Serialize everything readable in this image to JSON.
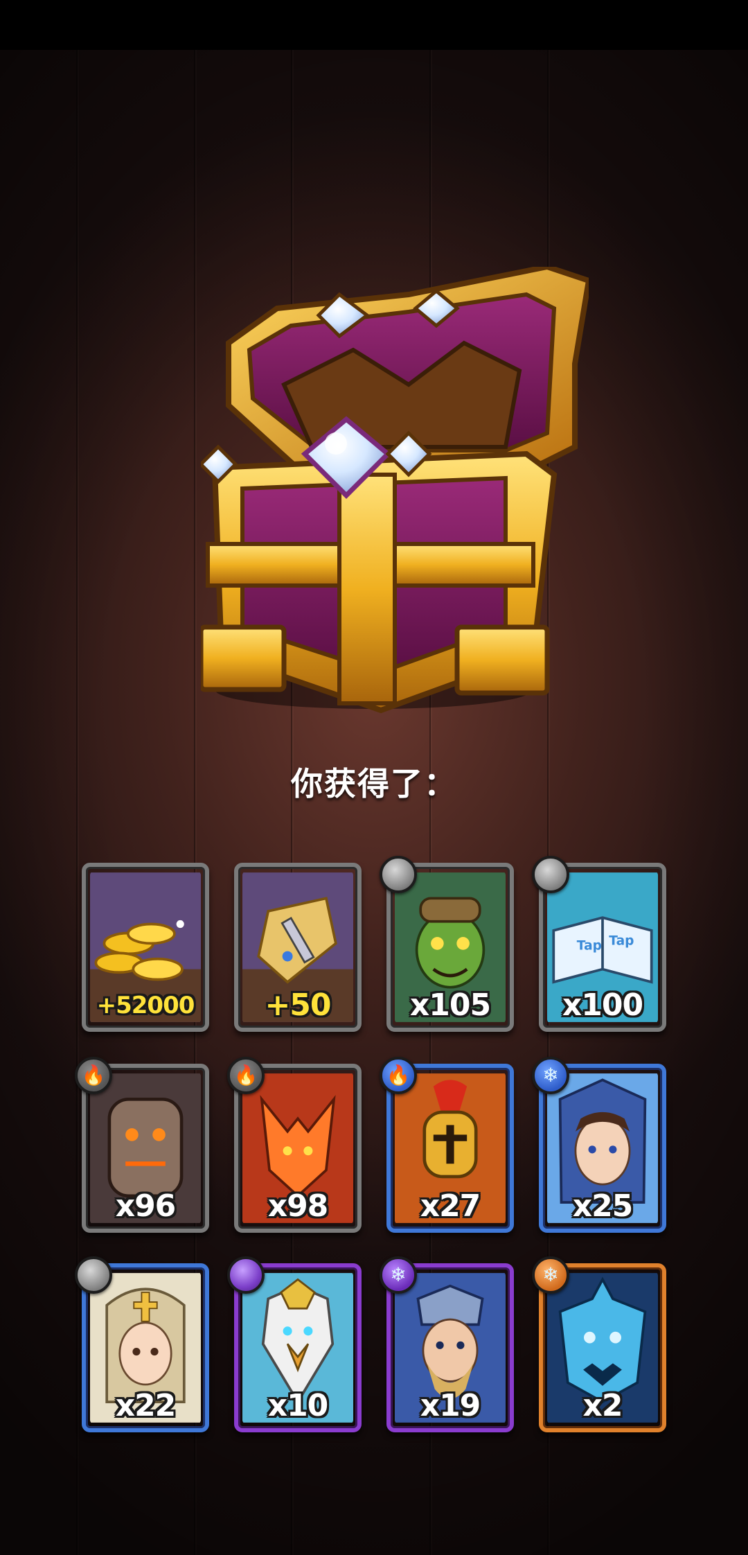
{
  "reward_screen": {
    "title": "你获得了："
  },
  "rewards": [
    {
      "id": "gold",
      "label": "+52000",
      "rarity": "grey",
      "badge": "",
      "art": "gold-coins-icon"
    },
    {
      "id": "scroll",
      "label": "+50",
      "rarity": "grey",
      "badge": "",
      "art": "scroll-icon"
    },
    {
      "id": "goblin",
      "label": "x105",
      "rarity": "grey",
      "badge": "stone",
      "art": "goblin-hero"
    },
    {
      "id": "tome",
      "label": "x100",
      "rarity": "grey",
      "badge": "stone",
      "art": "taptap-book-icon"
    },
    {
      "id": "golem",
      "label": "x96",
      "rarity": "grey",
      "badge": "fire",
      "art": "lava-golem-hero"
    },
    {
      "id": "fox",
      "label": "x98",
      "rarity": "grey",
      "badge": "fire",
      "art": "fire-fox-hero"
    },
    {
      "id": "spartan",
      "label": "x27",
      "rarity": "blue",
      "badge": "fire",
      "art": "spartan-hero"
    },
    {
      "id": "elf",
      "label": "x25",
      "rarity": "blue",
      "badge": "ice",
      "art": "elf-mage-hero"
    },
    {
      "id": "priestess",
      "label": "x22",
      "rarity": "blue",
      "badge": "stone",
      "art": "priestess-hero"
    },
    {
      "id": "griffin",
      "label": "x10",
      "rarity": "purple",
      "badge": "stone",
      "art": "griffin-knight-hero"
    },
    {
      "id": "frost-king",
      "label": "x19",
      "rarity": "purple",
      "badge": "ice",
      "art": "frost-king-hero"
    },
    {
      "id": "ice-dragon",
      "label": "x2",
      "rarity": "orange",
      "badge": "ice",
      "art": "ice-dragon-hero"
    }
  ]
}
